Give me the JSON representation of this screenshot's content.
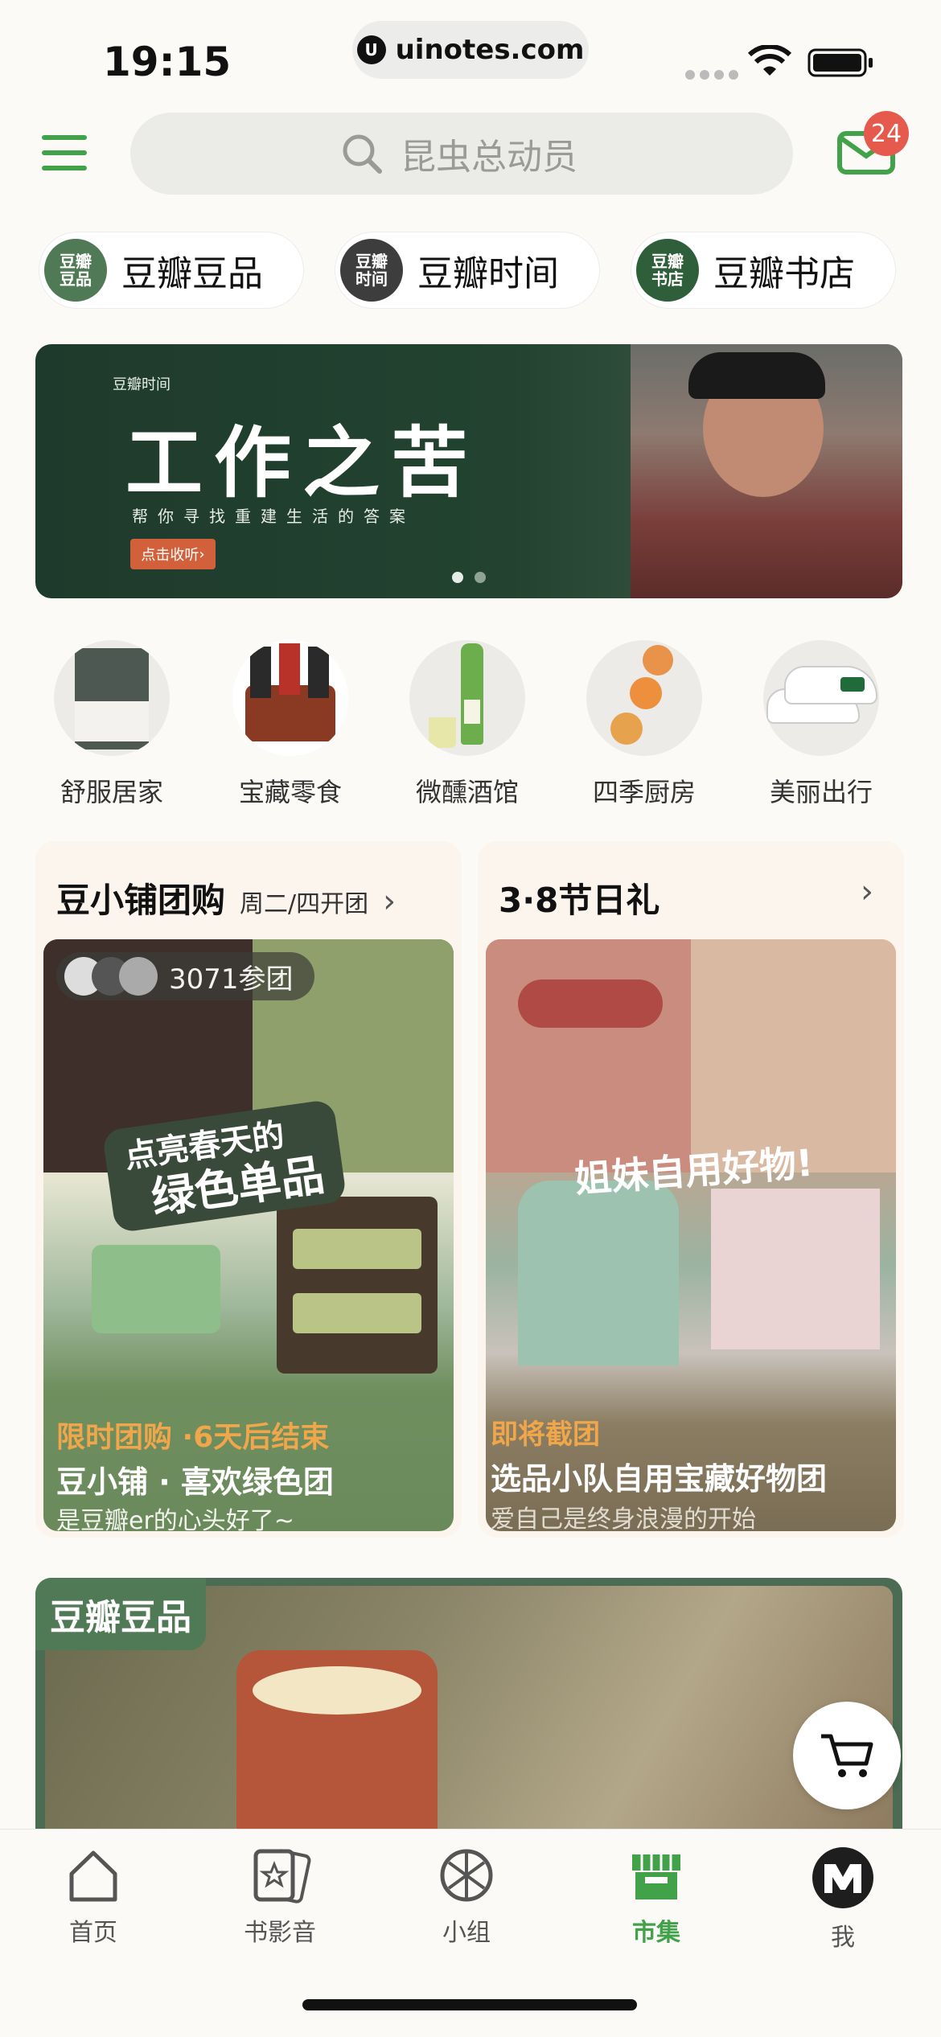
{
  "status_bar": {
    "time": "19:15",
    "url": "uinotes.com"
  },
  "header": {
    "search_placeholder": "昆虫总动员",
    "mail_badge": "24"
  },
  "shortcuts": [
    {
      "icon_text": "豆瓣\n豆品",
      "label": "豆瓣豆品",
      "color": "#4f7a55"
    },
    {
      "icon_text": "豆瓣\n时间",
      "label": "豆瓣时间",
      "color": "#3d3d3d"
    },
    {
      "icon_text": "豆瓣\n书店",
      "label": "豆瓣书店",
      "color": "#2f5f3a"
    }
  ],
  "banner": {
    "brand": "豆瓣时间",
    "title": "工作之苦",
    "subtitle": "帮你寻找重建生活的答案",
    "button": "点击收听",
    "page_count": 2,
    "active_page": 1
  },
  "categories": [
    {
      "label": "舒服居家"
    },
    {
      "label": "宝藏零食"
    },
    {
      "label": "微醺酒馆"
    },
    {
      "label": "四季厨房"
    },
    {
      "label": "美丽出行"
    }
  ],
  "group_card": {
    "title": "豆小铺团购",
    "subtitle": "周二/四开团",
    "participants": "3071参团",
    "image_text_line1": "点亮春天的",
    "image_text_line2": "绿色单品",
    "tag": "限时团购 ·6天后结束",
    "item_title": "豆小铺 · 喜欢绿色团",
    "item_desc": "是豆瓣er的心头好了~"
  },
  "holiday_card": {
    "title": "3·8节日礼",
    "image_text": "姐妹自用好物!",
    "tag": "即将截团",
    "item_title": "选品小队自用宝藏好物团",
    "item_desc": "爱自己是终身浪漫的开始"
  },
  "product_section": {
    "tag": "豆瓣豆品"
  },
  "tabs": [
    {
      "label": "首页",
      "icon": "home-icon",
      "active": false
    },
    {
      "label": "书影音",
      "icon": "star-card-icon",
      "active": false
    },
    {
      "label": "小组",
      "icon": "group-icon",
      "active": false
    },
    {
      "label": "市集",
      "icon": "store-icon",
      "active": true
    },
    {
      "label": "我",
      "icon": "avatar-icon",
      "active": false
    }
  ],
  "colors": {
    "accent": "#42a24a",
    "badge": "#e55a4d",
    "tag_orange": "#f0a64a"
  }
}
